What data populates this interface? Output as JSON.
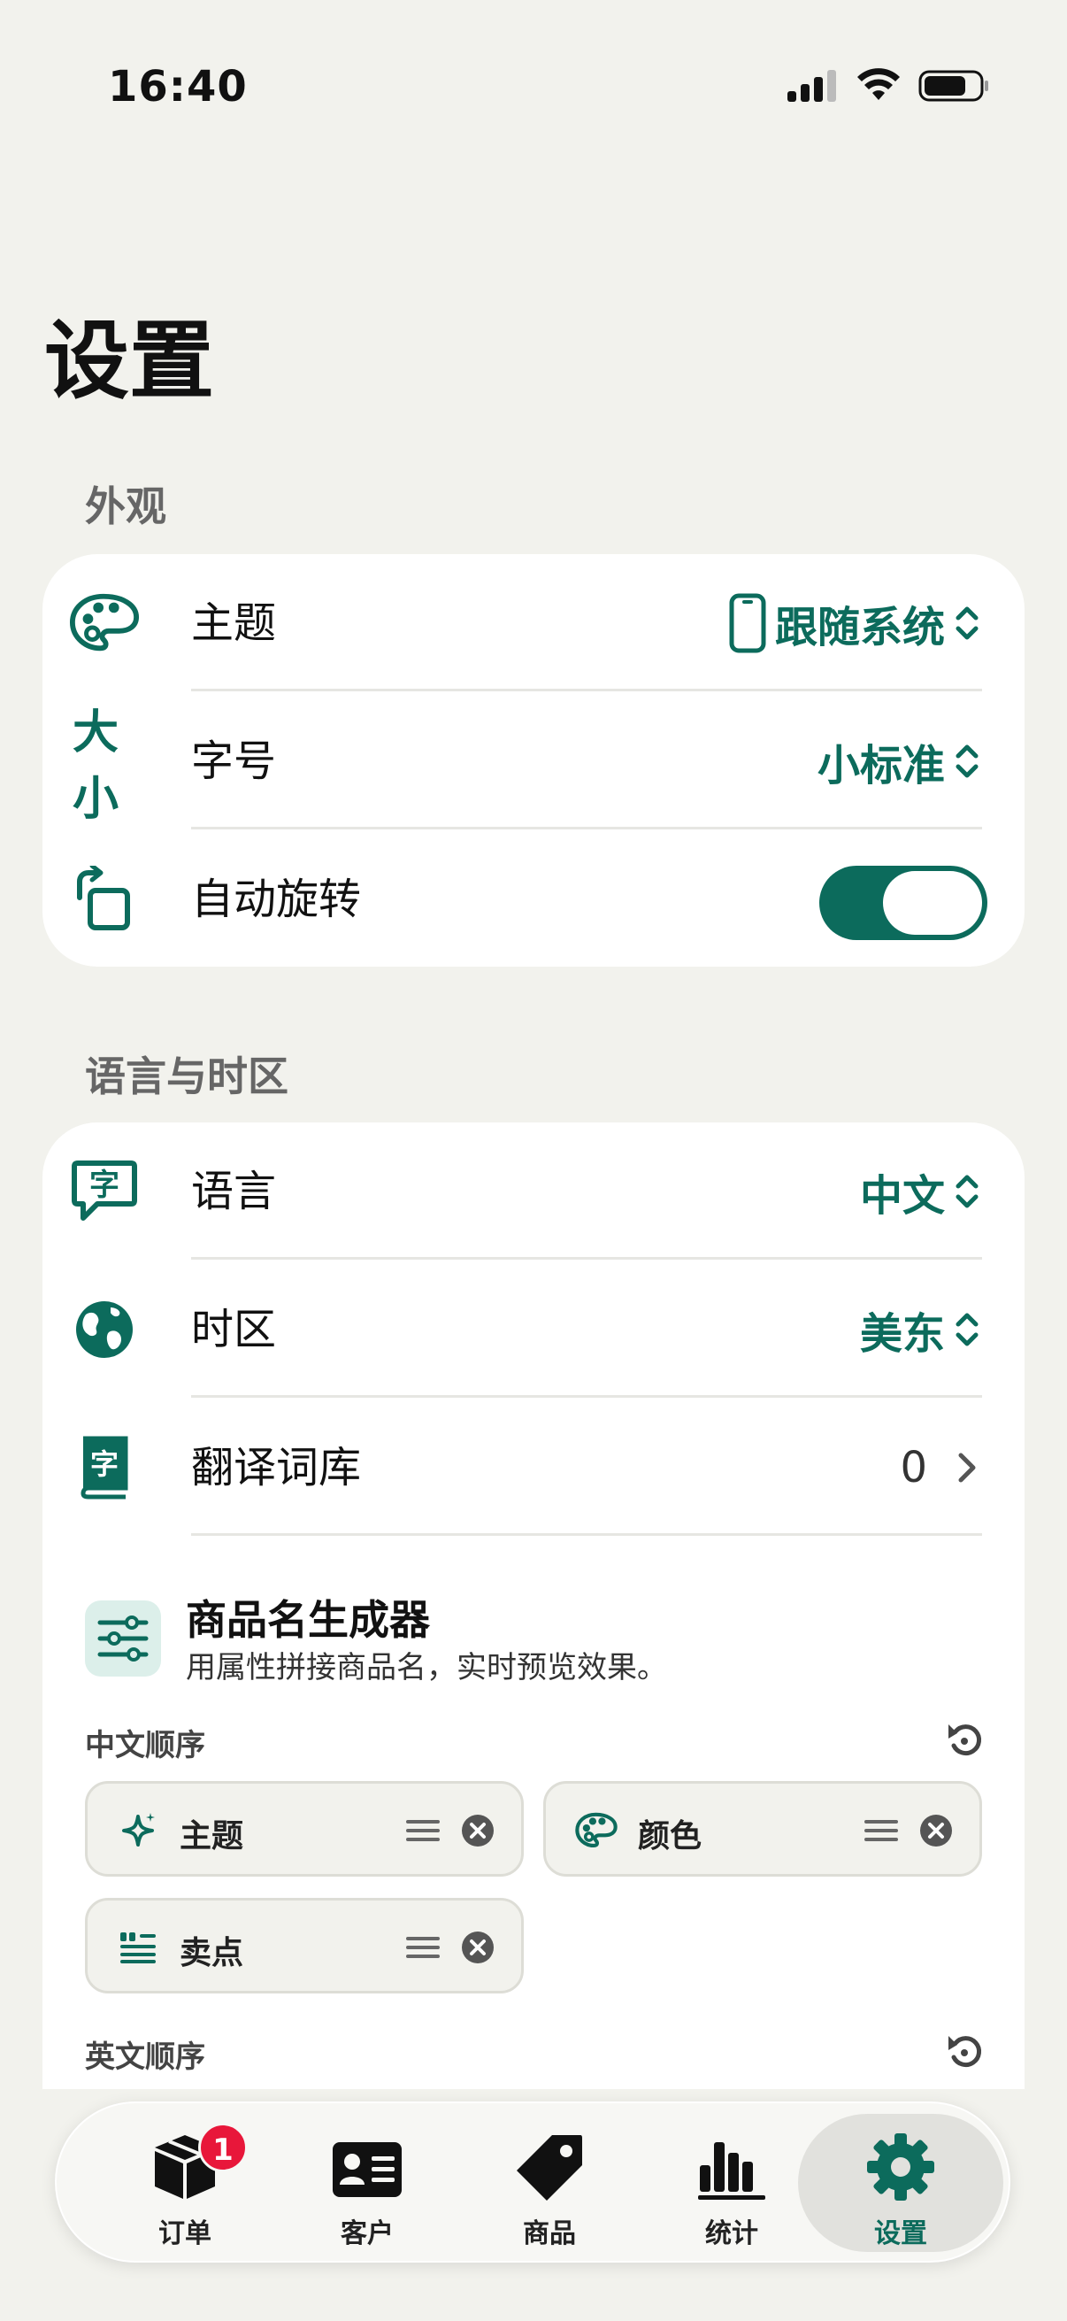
{
  "status_bar": {
    "time": "16:40"
  },
  "page": {
    "title": "设置"
  },
  "appearance": {
    "section_label": "外观",
    "theme": {
      "label": "主题",
      "value": "跟随系统"
    },
    "font_size": {
      "label": "字号",
      "icon_text": "大小",
      "value": "小标准"
    },
    "auto_rotate": {
      "label": "自动旋转",
      "enabled": true
    }
  },
  "language_timezone": {
    "section_label": "语言与时区",
    "language": {
      "label": "语言",
      "value": "中文",
      "icon_text": "字"
    },
    "timezone": {
      "label": "时区",
      "value": "美东"
    },
    "dictionary": {
      "label": "翻译词库",
      "value": "0",
      "icon_text": "字"
    }
  },
  "name_generator": {
    "title": "商品名生成器",
    "subtitle": "用属性拼接商品名，实时预览效果。",
    "chinese_order_label": "中文顺序",
    "chinese_chips": [
      {
        "label": "主题",
        "icon": "sparkle-icon"
      },
      {
        "label": "颜色",
        "icon": "palette-icon"
      },
      {
        "label": "卖点",
        "icon": "quote-list-icon"
      }
    ],
    "english_order_label": "英文顺序"
  },
  "tab_bar": {
    "tabs": [
      {
        "label": "订单",
        "icon": "box-icon",
        "badge": "1"
      },
      {
        "label": "客户",
        "icon": "contact-card-icon"
      },
      {
        "label": "商品",
        "icon": "tag-icon"
      },
      {
        "label": "统计",
        "icon": "bar-chart-icon"
      },
      {
        "label": "设置",
        "icon": "gear-icon",
        "active": true
      }
    ]
  },
  "colors": {
    "accent": "#0c6b5c",
    "background": "#f2f2ed",
    "card": "#ffffff",
    "badge": "#e8173a"
  }
}
